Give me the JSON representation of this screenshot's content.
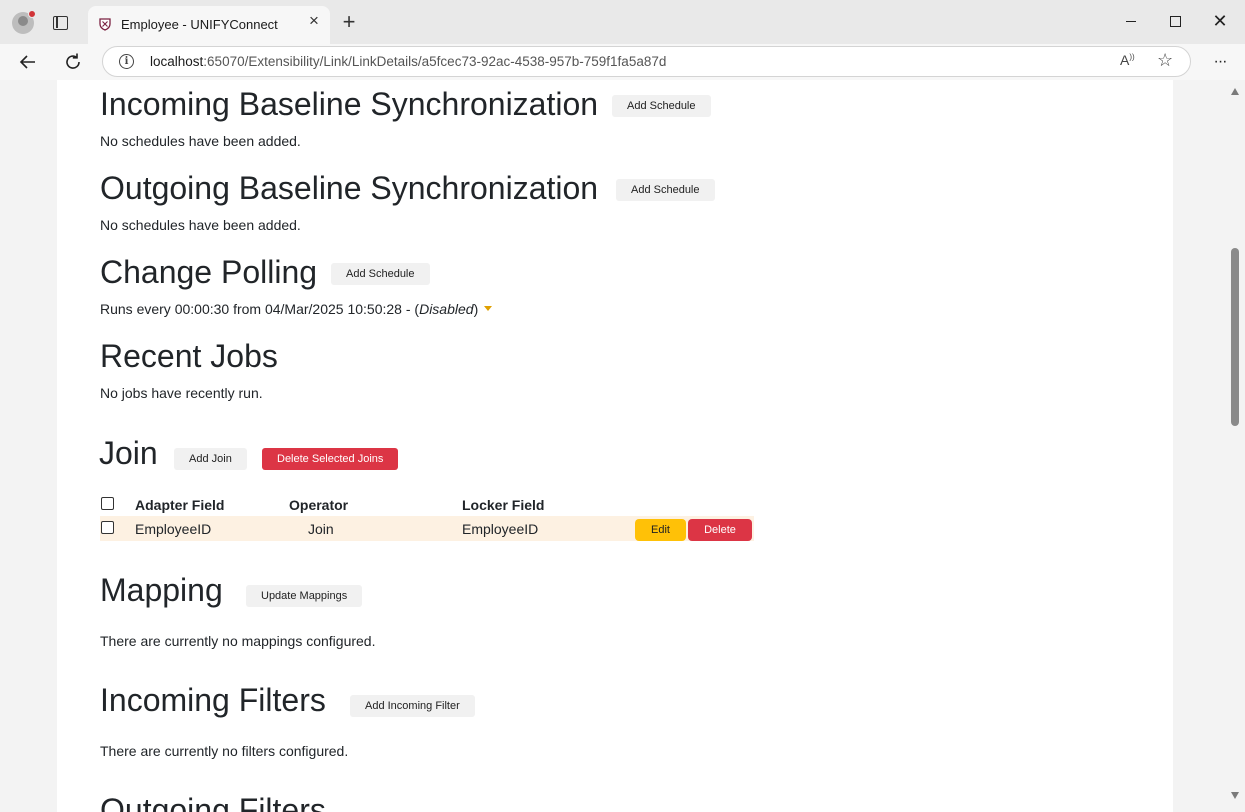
{
  "browser": {
    "tab_title": "Employee - UNIFYConnect",
    "url_host": "localhost",
    "url_rest": ":65070/Extensibility/Link/LinkDetails/a5fcec73-92ac-4538-957b-759f1fa5a87d"
  },
  "sections": {
    "incoming_baseline": {
      "title": "Incoming Baseline Synchronization",
      "button": "Add Schedule",
      "message": "No schedules have been added."
    },
    "outgoing_baseline": {
      "title": "Outgoing Baseline Synchronization",
      "button": "Add Schedule",
      "message": "No schedules have been added."
    },
    "change_polling": {
      "title": "Change Polling",
      "button": "Add Schedule",
      "schedule_text": "Runs every 00:00:30 from 04/Mar/2025 10:50:28 - (",
      "status": "Disabled",
      "schedule_suffix": ")"
    },
    "recent_jobs": {
      "title": "Recent Jobs",
      "message": "No jobs have recently run."
    },
    "join": {
      "title": "Join",
      "add_button": "Add Join",
      "delete_button": "Delete Selected Joins",
      "columns": [
        "Adapter Field",
        "Operator",
        "Locker Field"
      ],
      "rows": [
        {
          "adapter_field": "EmployeeID",
          "operator": "Join",
          "locker_field": "EmployeeID",
          "edit": "Edit",
          "delete": "Delete"
        }
      ]
    },
    "mapping": {
      "title": "Mapping",
      "button": "Update Mappings",
      "message": "There are currently no mappings configured."
    },
    "incoming_filters": {
      "title": "Incoming Filters",
      "button": "Add Incoming Filter",
      "message": "There are currently no filters configured."
    },
    "outgoing_filters": {
      "title": "Outgoing Filters"
    }
  },
  "colors": {
    "danger": "#dc3545",
    "warning": "#ffc107",
    "row_highlight": "#fdf1e2",
    "caret": "#e0a000"
  }
}
